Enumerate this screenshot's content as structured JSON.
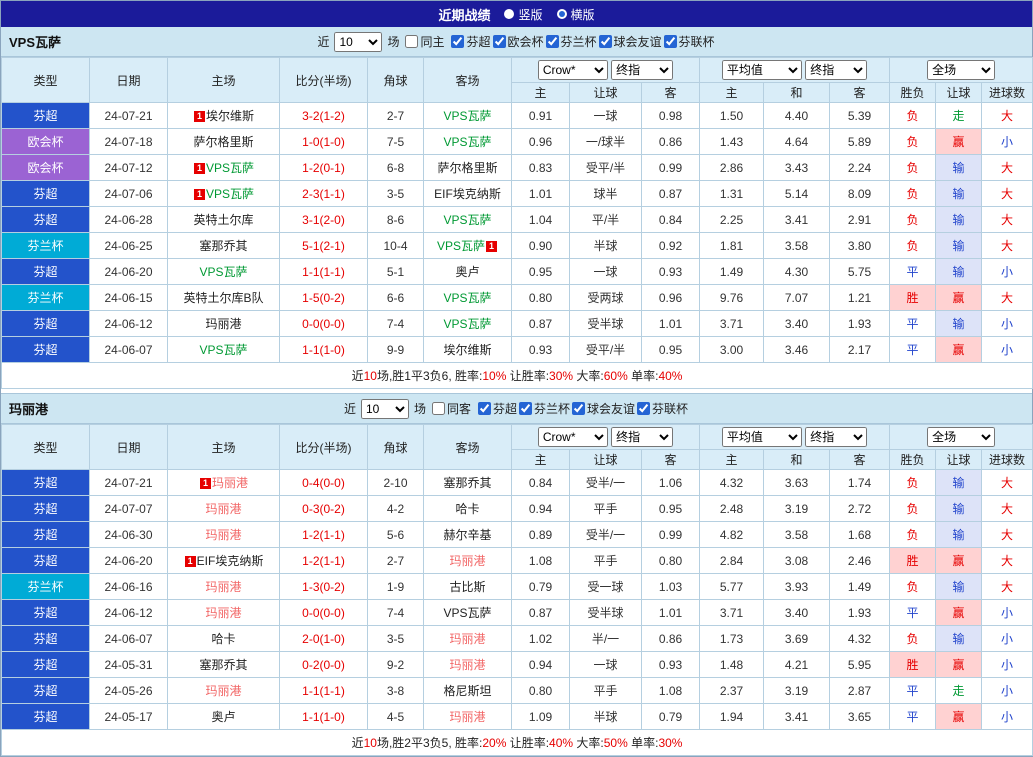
{
  "topbar": {
    "title": "近期战绩",
    "views": [
      {
        "label": "竖版",
        "selected": false
      },
      {
        "label": "横版",
        "selected": true
      }
    ]
  },
  "table_head": {
    "main_cols": [
      "类型",
      "日期",
      "主场",
      "比分(半场)",
      "角球",
      "客场"
    ],
    "odds_selects": [
      "Crow*",
      "终指"
    ],
    "avg_selects": [
      "平均值",
      "终指"
    ],
    "full_select": "全场",
    "odds_sub": [
      "主",
      "让球",
      "客"
    ],
    "avg_sub": [
      "主",
      "和",
      "客"
    ],
    "full_sub": [
      "胜负",
      "让球",
      "进球数"
    ]
  },
  "styles": {
    "league_colors": {
      "芬超": "#2353cb",
      "欧会杯": "#9b63d3",
      "芬兰杯": "#00abd6"
    },
    "team_colors": {
      "green": "#009933",
      "red": "#f26666"
    },
    "result_styles": {
      "胜": {
        "color": "#e60000",
        "bg": "#ffd2d2"
      },
      "平": {
        "color": "#2244cc",
        "bg": ""
      },
      "负": {
        "color": "#e60000",
        "bg": ""
      },
      "赢": {
        "color": "#e60000",
        "bg": "#ffd2d2"
      },
      "输": {
        "color": "#2244cc",
        "bg": "#dde3f8"
      },
      "走": {
        "color": "#009933",
        "bg": ""
      },
      "大": {
        "color": "#e60000",
        "bg": ""
      },
      "小": {
        "color": "#2244cc",
        "bg": ""
      }
    }
  },
  "sections": [
    {
      "team": "VPS瓦萨",
      "filter": {
        "near": "近",
        "count": "10",
        "unit": "场",
        "same": {
          "label": "同主",
          "checked": false
        },
        "leagues": [
          {
            "label": "芬超",
            "checked": true
          },
          {
            "label": "欧会杯",
            "checked": true
          },
          {
            "label": "芬兰杯",
            "checked": true
          },
          {
            "label": "球会友谊",
            "checked": true
          },
          {
            "label": "芬联杯",
            "checked": true
          }
        ]
      },
      "rows": [
        {
          "league": "芬超",
          "date": "24-07-21",
          "home": {
            "name": "埃尔维斯",
            "rc": "1",
            "rc_pos": "before"
          },
          "score": "3-2(1-2)",
          "corners": "2-7",
          "away": {
            "name": "VPS瓦萨",
            "hl": "green"
          },
          "odds": [
            "0.91",
            "一球",
            "0.98"
          ],
          "avg": [
            "1.50",
            "4.40",
            "5.39"
          ],
          "result": "负",
          "handicap": "走",
          "goals": "大"
        },
        {
          "league": "欧会杯",
          "date": "24-07-18",
          "home": {
            "name": "萨尔格里斯"
          },
          "score": "1-0(1-0)",
          "corners": "7-5",
          "away": {
            "name": "VPS瓦萨",
            "hl": "green"
          },
          "odds": [
            "0.96",
            "一/球半",
            "0.86"
          ],
          "avg": [
            "1.43",
            "4.64",
            "5.89"
          ],
          "result": "负",
          "handicap": "赢",
          "goals": "小"
        },
        {
          "league": "欧会杯",
          "date": "24-07-12",
          "home": {
            "name": "VPS瓦萨",
            "hl": "green",
            "rc": "1",
            "rc_pos": "before"
          },
          "score": "1-2(0-1)",
          "corners": "6-8",
          "away": {
            "name": "萨尔格里斯"
          },
          "odds": [
            "0.83",
            "受平/半",
            "0.99"
          ],
          "avg": [
            "2.86",
            "3.43",
            "2.24"
          ],
          "result": "负",
          "handicap": "输",
          "goals": "大"
        },
        {
          "league": "芬超",
          "date": "24-07-06",
          "home": {
            "name": "VPS瓦萨",
            "hl": "green",
            "rc": "1",
            "rc_pos": "before"
          },
          "score": "2-3(1-1)",
          "corners": "3-5",
          "away": {
            "name": "EIF埃克纳斯"
          },
          "odds": [
            "1.01",
            "球半",
            "0.87"
          ],
          "avg": [
            "1.31",
            "5.14",
            "8.09"
          ],
          "result": "负",
          "handicap": "输",
          "goals": "大"
        },
        {
          "league": "芬超",
          "date": "24-06-28",
          "home": {
            "name": "英特土尔库"
          },
          "score": "3-1(2-0)",
          "corners": "8-6",
          "away": {
            "name": "VPS瓦萨",
            "hl": "green"
          },
          "odds": [
            "1.04",
            "平/半",
            "0.84"
          ],
          "avg": [
            "2.25",
            "3.41",
            "2.91"
          ],
          "result": "负",
          "handicap": "输",
          "goals": "大"
        },
        {
          "league": "芬兰杯",
          "date": "24-06-25",
          "home": {
            "name": "塞那乔其"
          },
          "score": "5-1(2-1)",
          "corners": "10-4",
          "away": {
            "name": "VPS瓦萨",
            "hl": "green",
            "rc": "1",
            "rc_pos": "after"
          },
          "odds": [
            "0.90",
            "半球",
            "0.92"
          ],
          "avg": [
            "1.81",
            "3.58",
            "3.80"
          ],
          "result": "负",
          "handicap": "输",
          "goals": "大"
        },
        {
          "league": "芬超",
          "date": "24-06-20",
          "home": {
            "name": "VPS瓦萨",
            "hl": "green"
          },
          "score": "1-1(1-1)",
          "corners": "5-1",
          "away": {
            "name": "奥卢"
          },
          "odds": [
            "0.95",
            "一球",
            "0.93"
          ],
          "avg": [
            "1.49",
            "4.30",
            "5.75"
          ],
          "result": "平",
          "handicap": "输",
          "goals": "小"
        },
        {
          "league": "芬兰杯",
          "date": "24-06-15",
          "home": {
            "name": "英特土尔库B队"
          },
          "score": "1-5(0-2)",
          "corners": "6-6",
          "away": {
            "name": "VPS瓦萨",
            "hl": "green"
          },
          "odds": [
            "0.80",
            "受两球",
            "0.96"
          ],
          "avg": [
            "9.76",
            "7.07",
            "1.21"
          ],
          "result": "胜",
          "handicap": "赢",
          "goals": "大"
        },
        {
          "league": "芬超",
          "date": "24-06-12",
          "home": {
            "name": "玛丽港"
          },
          "score": "0-0(0-0)",
          "corners": "7-4",
          "away": {
            "name": "VPS瓦萨",
            "hl": "green"
          },
          "odds": [
            "0.87",
            "受半球",
            "1.01"
          ],
          "avg": [
            "3.71",
            "3.40",
            "1.93"
          ],
          "result": "平",
          "handicap": "输",
          "goals": "小"
        },
        {
          "league": "芬超",
          "date": "24-06-07",
          "home": {
            "name": "VPS瓦萨",
            "hl": "green"
          },
          "score": "1-1(1-0)",
          "corners": "9-9",
          "away": {
            "name": "埃尔维斯"
          },
          "odds": [
            "0.93",
            "受平/半",
            "0.95"
          ],
          "avg": [
            "3.00",
            "3.46",
            "2.17"
          ],
          "result": "平",
          "handicap": "赢",
          "goals": "小"
        }
      ],
      "summary": [
        {
          "t": "近"
        },
        {
          "t": "10",
          "red": true
        },
        {
          "t": "场,胜1平3负6, "
        },
        {
          "t": "胜率:"
        },
        {
          "t": "10%",
          "red": true
        },
        {
          "t": " 让胜率:"
        },
        {
          "t": "30%",
          "red": true
        },
        {
          "t": " 大率:"
        },
        {
          "t": "60%",
          "red": true
        },
        {
          "t": " 单率:"
        },
        {
          "t": "40%",
          "red": true
        }
      ]
    },
    {
      "team": "玛丽港",
      "filter": {
        "near": "近",
        "count": "10",
        "unit": "场",
        "same": {
          "label": "同客",
          "checked": false
        },
        "leagues": [
          {
            "label": "芬超",
            "checked": true
          },
          {
            "label": "芬兰杯",
            "checked": true
          },
          {
            "label": "球会友谊",
            "checked": true
          },
          {
            "label": "芬联杯",
            "checked": true
          }
        ]
      },
      "rows": [
        {
          "league": "芬超",
          "date": "24-07-21",
          "home": {
            "name": "玛丽港",
            "hl": "red",
            "rc": "1",
            "rc_pos": "before"
          },
          "score": "0-4(0-0)",
          "corners": "2-10",
          "away": {
            "name": "塞那乔其"
          },
          "odds": [
            "0.84",
            "受半/一",
            "1.06"
          ],
          "avg": [
            "4.32",
            "3.63",
            "1.74"
          ],
          "result": "负",
          "handicap": "输",
          "goals": "大"
        },
        {
          "league": "芬超",
          "date": "24-07-07",
          "home": {
            "name": "玛丽港",
            "hl": "red"
          },
          "score": "0-3(0-2)",
          "corners": "4-2",
          "away": {
            "name": "哈卡"
          },
          "odds": [
            "0.94",
            "平手",
            "0.95"
          ],
          "avg": [
            "2.48",
            "3.19",
            "2.72"
          ],
          "result": "负",
          "handicap": "输",
          "goals": "大"
        },
        {
          "league": "芬超",
          "date": "24-06-30",
          "home": {
            "name": "玛丽港",
            "hl": "red"
          },
          "score": "1-2(1-1)",
          "corners": "5-6",
          "away": {
            "name": "赫尔辛基"
          },
          "odds": [
            "0.89",
            "受半/一",
            "0.99"
          ],
          "avg": [
            "4.82",
            "3.58",
            "1.68"
          ],
          "result": "负",
          "handicap": "输",
          "goals": "大"
        },
        {
          "league": "芬超",
          "date": "24-06-20",
          "home": {
            "name": "EIF埃克纳斯",
            "rc": "1",
            "rc_pos": "before"
          },
          "score": "1-2(1-1)",
          "corners": "2-7",
          "away": {
            "name": "玛丽港",
            "hl": "red"
          },
          "odds": [
            "1.08",
            "平手",
            "0.80"
          ],
          "avg": [
            "2.84",
            "3.08",
            "2.46"
          ],
          "result": "胜",
          "handicap": "赢",
          "goals": "大"
        },
        {
          "league": "芬兰杯",
          "date": "24-06-16",
          "home": {
            "name": "玛丽港",
            "hl": "red"
          },
          "score": "1-3(0-2)",
          "corners": "1-9",
          "away": {
            "name": "古比斯"
          },
          "odds": [
            "0.79",
            "受一球",
            "1.03"
          ],
          "avg": [
            "5.77",
            "3.93",
            "1.49"
          ],
          "result": "负",
          "handicap": "输",
          "goals": "大"
        },
        {
          "league": "芬超",
          "date": "24-06-12",
          "home": {
            "name": "玛丽港",
            "hl": "red"
          },
          "score": "0-0(0-0)",
          "corners": "7-4",
          "away": {
            "name": "VPS瓦萨"
          },
          "odds": [
            "0.87",
            "受半球",
            "1.01"
          ],
          "avg": [
            "3.71",
            "3.40",
            "1.93"
          ],
          "result": "平",
          "handicap": "赢",
          "goals": "小"
        },
        {
          "league": "芬超",
          "date": "24-06-07",
          "home": {
            "name": "哈卡"
          },
          "score": "2-0(1-0)",
          "corners": "3-5",
          "away": {
            "name": "玛丽港",
            "hl": "red"
          },
          "odds": [
            "1.02",
            "半/一",
            "0.86"
          ],
          "avg": [
            "1.73",
            "3.69",
            "4.32"
          ],
          "result": "负",
          "handicap": "输",
          "goals": "小"
        },
        {
          "league": "芬超",
          "date": "24-05-31",
          "home": {
            "name": "塞那乔其"
          },
          "score": "0-2(0-0)",
          "corners": "9-2",
          "away": {
            "name": "玛丽港",
            "hl": "red"
          },
          "odds": [
            "0.94",
            "一球",
            "0.93"
          ],
          "avg": [
            "1.48",
            "4.21",
            "5.95"
          ],
          "result": "胜",
          "handicap": "赢",
          "goals": "小"
        },
        {
          "league": "芬超",
          "date": "24-05-26",
          "home": {
            "name": "玛丽港",
            "hl": "red"
          },
          "score": "1-1(1-1)",
          "corners": "3-8",
          "away": {
            "name": "格尼斯坦"
          },
          "odds": [
            "0.80",
            "平手",
            "1.08"
          ],
          "avg": [
            "2.37",
            "3.19",
            "2.87"
          ],
          "result": "平",
          "handicap": "走",
          "goals": "小"
        },
        {
          "league": "芬超",
          "date": "24-05-17",
          "home": {
            "name": "奥卢"
          },
          "score": "1-1(1-0)",
          "corners": "4-5",
          "away": {
            "name": "玛丽港",
            "hl": "red"
          },
          "odds": [
            "1.09",
            "半球",
            "0.79"
          ],
          "avg": [
            "1.94",
            "3.41",
            "3.65"
          ],
          "result": "平",
          "handicap": "赢",
          "goals": "小"
        }
      ],
      "summary": [
        {
          "t": "近"
        },
        {
          "t": "10",
          "red": true
        },
        {
          "t": "场,胜2平3负5, "
        },
        {
          "t": "胜率:"
        },
        {
          "t": "20%",
          "red": true
        },
        {
          "t": " 让胜率:"
        },
        {
          "t": "40%",
          "red": true
        },
        {
          "t": " 大率:"
        },
        {
          "t": "50%",
          "red": true
        },
        {
          "t": " 单率:"
        },
        {
          "t": "30%",
          "red": true
        }
      ]
    }
  ]
}
